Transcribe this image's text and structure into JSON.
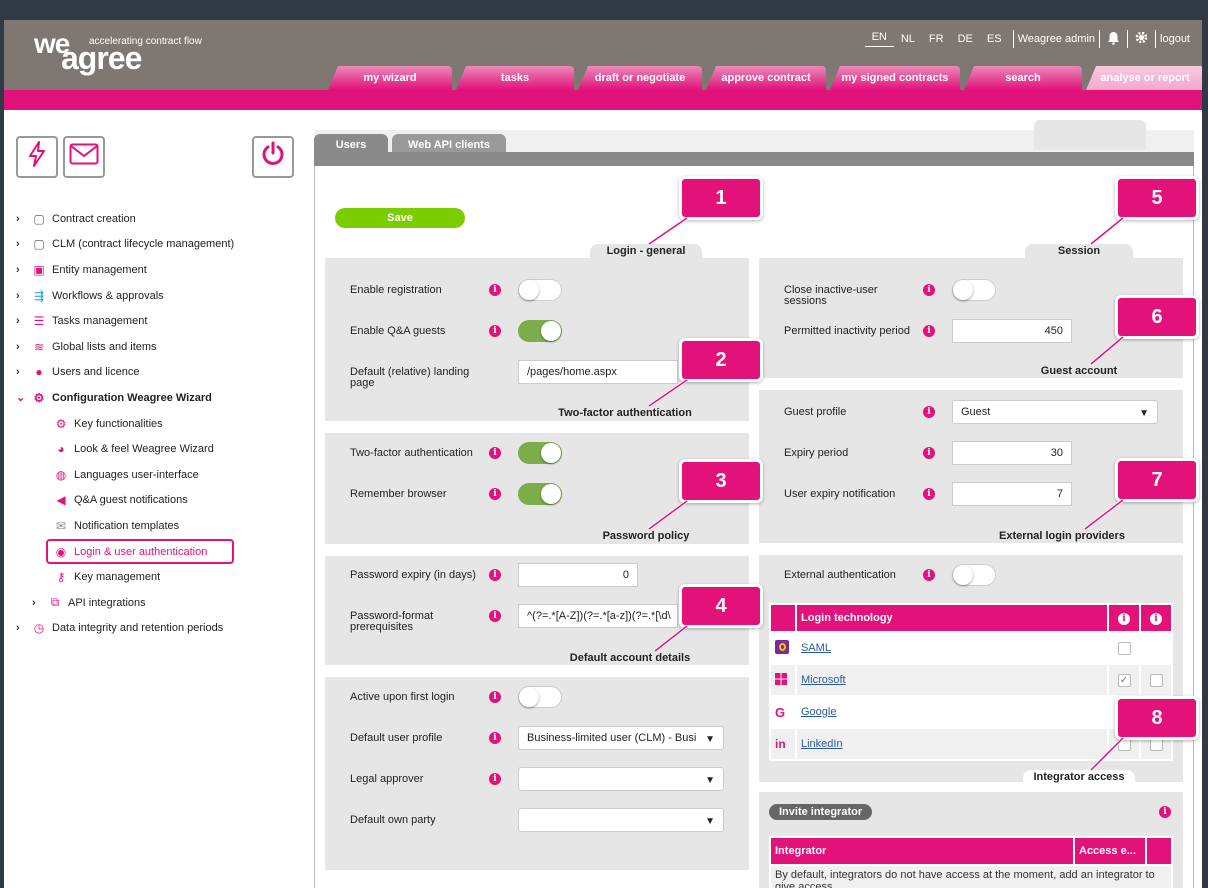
{
  "header": {
    "logo_we": "we",
    "logo_agree": "agree",
    "logo_tagline": "accelerating contract flow",
    "languages": [
      "EN",
      "NL",
      "FR",
      "DE",
      "ES"
    ],
    "active_language": "EN",
    "user": "Weagree admin",
    "logout": "logout",
    "icons": [
      "bell-icon",
      "gear-icon"
    ]
  },
  "nav_tabs": [
    "my wizard",
    "tasks",
    "draft or negotiate",
    "approve contract",
    "my signed contracts",
    "search",
    "analyse or report"
  ],
  "sidebar": {
    "quick_buttons": [
      "lightning-icon",
      "envelope-icon",
      "power-icon"
    ],
    "items": [
      {
        "label": "Contract creation",
        "icon": "document-icon"
      },
      {
        "label": "CLM (contract lifecycle management)",
        "icon": "document-icon"
      },
      {
        "label": "Entity management",
        "icon": "id-card-icon"
      },
      {
        "label": "Workflows & approvals",
        "icon": "workflow-icon"
      },
      {
        "label": "Tasks management",
        "icon": "tasks-icon"
      },
      {
        "label": "Global lists and items",
        "icon": "database-icon"
      },
      {
        "label": "Users and licence",
        "icon": "user-icon"
      },
      {
        "label": "Configuration Weagree Wizard",
        "icon": "cogs-icon"
      }
    ],
    "sub_items": [
      {
        "label": "Key functionalities",
        "icon": "gear-icon"
      },
      {
        "label": "Look & feel Weagree Wizard",
        "icon": "palette-icon"
      },
      {
        "label": "Languages user-interface",
        "icon": "globe-icon"
      },
      {
        "label": "Q&A guest notifications",
        "icon": "megaphone-icon"
      },
      {
        "label": "Notification templates",
        "icon": "envelope-open-icon"
      },
      {
        "label": "Login & user authentication",
        "icon": "user-circle-icon"
      },
      {
        "label": "Key management",
        "icon": "key-icon"
      },
      {
        "label": "API integrations",
        "icon": "api-icon"
      }
    ],
    "last_item": {
      "label": "Data integrity and retention periods",
      "icon": "clock-icon"
    }
  },
  "main_tabs": [
    "Users",
    "Web API clients"
  ],
  "save_label": "Save",
  "login_general": {
    "title": "Login - general",
    "enable_registration": "Enable registration",
    "enable_registration_on": false,
    "enable_qa_guests": "Enable Q&A guests",
    "enable_qa_guests_on": true,
    "landing_page_label": "Default (relative) landing page",
    "landing_page_value": "/pages/home.aspx"
  },
  "two_factor": {
    "title": "Two-factor authentication",
    "tfa_label": "Two-factor authentication",
    "tfa_on": true,
    "remember_label": "Remember browser",
    "remember_on": true
  },
  "password_policy": {
    "title": "Password policy",
    "expiry_label": "Password expiry (in days)",
    "expiry_value": "0",
    "format_label": "Password-format prerequisites",
    "format_value": "^(?=.*[A-Z])(?=.*[a-z])(?=.*[\\d\\"
  },
  "default_account": {
    "title": "Default account details",
    "active_label": "Active upon first login",
    "active_on": false,
    "profile_label": "Default user profile",
    "profile_value": "Business-limited user (CLM) - Busi",
    "legal_label": "Legal approver",
    "legal_value": "",
    "party_label": "Default own party",
    "party_value": ""
  },
  "session": {
    "title": "Session",
    "close_label": "Close inactive-user sessions",
    "close_on": false,
    "period_label": "Permitted inactivity period",
    "period_value": "450"
  },
  "guest_account": {
    "title": "Guest account",
    "profile_label": "Guest profile",
    "profile_value": "Guest",
    "expiry_label": "Expiry period",
    "expiry_value": "30",
    "notif_label": "User expiry notification",
    "notif_value": "7"
  },
  "external_login": {
    "title": "External login providers",
    "ext_auth_label": "External authentication",
    "ext_auth_on": false,
    "table_header": "Login technology",
    "providers": [
      {
        "name": "SAML",
        "icon": "saml-icon",
        "c1": false,
        "c2": null
      },
      {
        "name": "Microsoft",
        "icon": "windows-icon",
        "c1": true,
        "c2": false
      },
      {
        "name": "Google",
        "icon": "google-icon",
        "c1": null,
        "c2": null
      },
      {
        "name": "LinkedIn",
        "icon": "linkedin-icon",
        "c1": false,
        "c2": false
      }
    ]
  },
  "integrator_access": {
    "title": "Integrator access",
    "invite": "Invite integrator",
    "col_integrator": "Integrator",
    "col_access": "Access e...",
    "empty_message": "By default, integrators do not have access at the moment, add an integrator to give access"
  },
  "callouts": [
    "1",
    "2",
    "3",
    "4",
    "5",
    "6",
    "7",
    "8"
  ],
  "colors": {
    "brand": "#e2127a",
    "toggle_on": "#7cad4a",
    "save": "#7ccd00",
    "header": "#7f7771"
  }
}
